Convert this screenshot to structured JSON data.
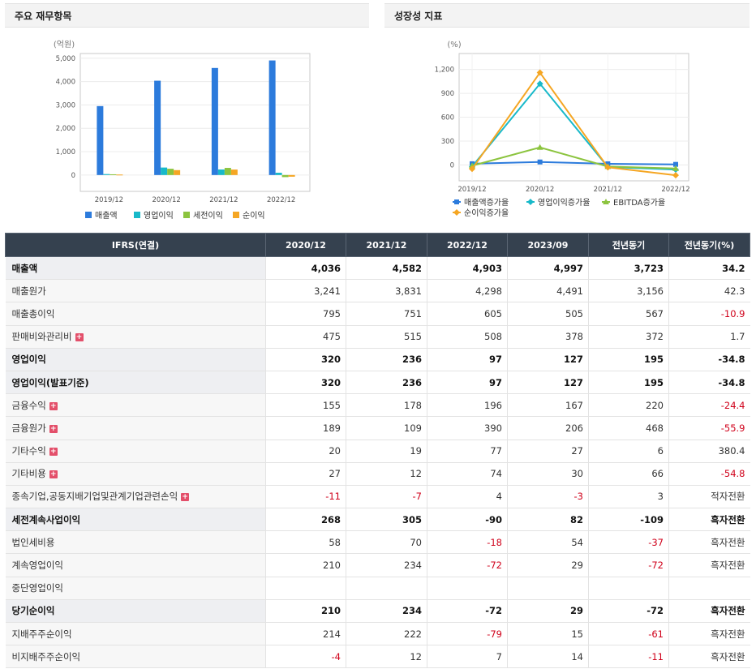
{
  "left_panel": {
    "title": "주요 재무항목"
  },
  "right_panel": {
    "title": "성장성 지표"
  },
  "chart_data": [
    {
      "type": "bar",
      "unit_label": "(억원)",
      "categories": [
        "2019/12",
        "2020/12",
        "2021/12",
        "2022/12"
      ],
      "series": [
        {
          "name": "매출액",
          "color": "#2c7bdc",
          "values": [
            2950,
            4036,
            4582,
            4903
          ]
        },
        {
          "name": "영업이익",
          "color": "#18b9c9",
          "values": [
            40,
            320,
            236,
            97
          ]
        },
        {
          "name": "세전이익",
          "color": "#8cc43f",
          "values": [
            30,
            268,
            305,
            -90
          ]
        },
        {
          "name": "순이익",
          "color": "#f5a623",
          "values": [
            20,
            210,
            234,
            -72
          ]
        }
      ],
      "ylim": [
        -700,
        5200
      ],
      "yticks": [
        0,
        1000,
        2000,
        3000,
        4000,
        5000
      ],
      "ytick_labels": [
        "0",
        "1,000",
        "2,000",
        "3,000",
        "4,000",
        "5,000"
      ],
      "grid": true,
      "legend": "bottom"
    },
    {
      "type": "line",
      "unit_label": "(%)",
      "categories": [
        "2019/12",
        "2020/12",
        "2021/12",
        "2022/12"
      ],
      "series": [
        {
          "name": "매출액증가율",
          "color": "#2c7bdc",
          "marker": "square",
          "values": [
            15,
            37,
            14,
            7
          ]
        },
        {
          "name": "영업이익증가율",
          "color": "#18b9c9",
          "marker": "diamond",
          "values": [
            -20,
            1020,
            -26,
            -59
          ]
        },
        {
          "name": "EBITDA증가율",
          "color": "#8cc43f",
          "marker": "triangle",
          "values": [
            -10,
            220,
            -20,
            -45
          ]
        },
        {
          "name": "순이익증가율",
          "color": "#f5a623",
          "marker": "diamond",
          "values": [
            -50,
            1160,
            -30,
            -130
          ]
        }
      ],
      "ylim": [
        -200,
        1400
      ],
      "yticks": [
        0,
        300,
        600,
        900,
        1200
      ],
      "ytick_labels": [
        "0",
        "300",
        "600",
        "900",
        "1,200"
      ],
      "grid": true,
      "legend": "bottom"
    }
  ],
  "table": {
    "header": [
      "IFRS(연결)",
      "2020/12",
      "2021/12",
      "2022/12",
      "2023/09",
      "전년동기",
      "전년동기(%)"
    ],
    "rows": [
      {
        "label": "매출액",
        "bold": true,
        "plus": false,
        "indent": false,
        "values": [
          "4,036",
          "4,582",
          "4,903",
          "4,997",
          "3,723",
          "34.2"
        ]
      },
      {
        "label": "매출원가",
        "bold": false,
        "plus": false,
        "indent": false,
        "values": [
          "3,241",
          "3,831",
          "4,298",
          "4,491",
          "3,156",
          "42.3"
        ]
      },
      {
        "label": "매출총이익",
        "bold": false,
        "plus": false,
        "indent": false,
        "values": [
          "795",
          "751",
          "605",
          "505",
          "567",
          "-10.9"
        ]
      },
      {
        "label": "판매비와관리비",
        "bold": false,
        "plus": true,
        "indent": false,
        "values": [
          "475",
          "515",
          "508",
          "378",
          "372",
          "1.7"
        ]
      },
      {
        "label": "영업이익",
        "bold": true,
        "plus": false,
        "indent": false,
        "values": [
          "320",
          "236",
          "97",
          "127",
          "195",
          "-34.8"
        ]
      },
      {
        "label": "영업이익(발표기준)",
        "bold": true,
        "plus": false,
        "indent": false,
        "values": [
          "320",
          "236",
          "97",
          "127",
          "195",
          "-34.8"
        ]
      },
      {
        "label": "금융수익",
        "bold": false,
        "plus": true,
        "indent": false,
        "values": [
          "155",
          "178",
          "196",
          "167",
          "220",
          "-24.4"
        ]
      },
      {
        "label": "금융원가",
        "bold": false,
        "plus": true,
        "indent": false,
        "values": [
          "189",
          "109",
          "390",
          "206",
          "468",
          "-55.9"
        ]
      },
      {
        "label": "기타수익",
        "bold": false,
        "plus": true,
        "indent": false,
        "values": [
          "20",
          "19",
          "77",
          "27",
          "6",
          "380.4"
        ]
      },
      {
        "label": "기타비용",
        "bold": false,
        "plus": true,
        "indent": false,
        "values": [
          "27",
          "12",
          "74",
          "30",
          "66",
          "-54.8"
        ]
      },
      {
        "label": "종속기업,공동지배기업및관계기업관련손익",
        "bold": false,
        "plus": true,
        "indent": false,
        "values": [
          "-11",
          "-7",
          "4",
          "-3",
          "3",
          "적자전환"
        ]
      },
      {
        "label": "세전계속사업이익",
        "bold": true,
        "plus": false,
        "indent": false,
        "values": [
          "268",
          "305",
          "-90",
          "82",
          "-109",
          "흑자전환"
        ]
      },
      {
        "label": "법인세비용",
        "bold": false,
        "plus": false,
        "indent": false,
        "values": [
          "58",
          "70",
          "-18",
          "54",
          "-37",
          "흑자전환"
        ]
      },
      {
        "label": "계속영업이익",
        "bold": false,
        "plus": false,
        "indent": false,
        "values": [
          "210",
          "234",
          "-72",
          "29",
          "-72",
          "흑자전환"
        ]
      },
      {
        "label": "중단영업이익",
        "bold": false,
        "plus": false,
        "indent": false,
        "values": [
          "",
          "",
          "",
          "",
          "",
          ""
        ]
      },
      {
        "label": "당기순이익",
        "bold": true,
        "plus": false,
        "indent": false,
        "values": [
          "210",
          "234",
          "-72",
          "29",
          "-72",
          "흑자전환"
        ]
      },
      {
        "label": "지배주주순이익",
        "bold": false,
        "plus": false,
        "indent": true,
        "values": [
          "214",
          "222",
          "-79",
          "15",
          "-61",
          "흑자전환"
        ]
      },
      {
        "label": "비지배주주순이익",
        "bold": false,
        "plus": false,
        "indent": true,
        "values": [
          "-4",
          "12",
          "7",
          "14",
          "-11",
          "흑자전환"
        ]
      }
    ]
  }
}
